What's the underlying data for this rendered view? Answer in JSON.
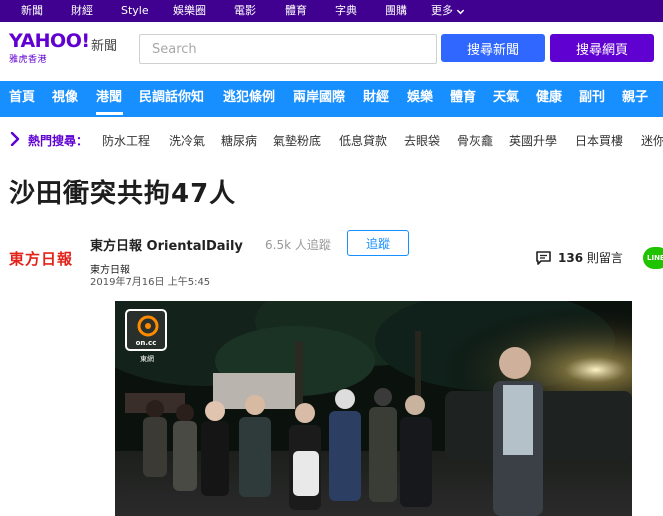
{
  "topbar": {
    "links": [
      "新聞",
      "財經",
      "Style",
      "娛樂圈",
      "電影",
      "體育",
      "字典",
      "團購"
    ],
    "more_label": "更多"
  },
  "header": {
    "logo_text": "YAHOO!",
    "logo_sub": "雅虎香港",
    "section_label": "新聞",
    "search_placeholder": "Search",
    "search_news_label": "搜尋新聞",
    "search_web_label": "搜尋網頁"
  },
  "nav": {
    "items": [
      "首頁",
      "視像",
      "港聞",
      "民調話你知",
      "逃犯條例",
      "兩岸國際",
      "財經",
      "娛樂",
      "體育",
      "天氣",
      "健康",
      "副刊",
      "親子"
    ],
    "active": "港聞"
  },
  "trending": {
    "label": "熱門搜尋：",
    "items": [
      "防水工程",
      "洗冷氣",
      "糖尿病",
      "氣墊粉底",
      "低息貸款",
      "去眼袋",
      "骨灰龕",
      "英國升學",
      "日本買樓",
      "迷你倉"
    ]
  },
  "article": {
    "headline": "沙田衝突共拘47人",
    "provider_logo_text": "東方日報",
    "provider_name": "東方日報 OrientalDaily",
    "followers": "6.5k 人追蹤",
    "follow_label": "追蹤",
    "source": "東方日報",
    "date": "2019年7月16日 上午5:45",
    "comment_count": "136",
    "comment_suffix": "則留言",
    "line_label": "LINE"
  },
  "photo": {
    "watermark_text": "on.cc",
    "watermark_label": "東網"
  },
  "colors": {
    "topbar": "#400090",
    "brand": "#6001d2",
    "nav": "#188fff",
    "search_news_btn": "#3068ff",
    "search_web_btn": "#5f01d1",
    "provider_red": "#e2231a",
    "line_green": "#1fc300"
  }
}
